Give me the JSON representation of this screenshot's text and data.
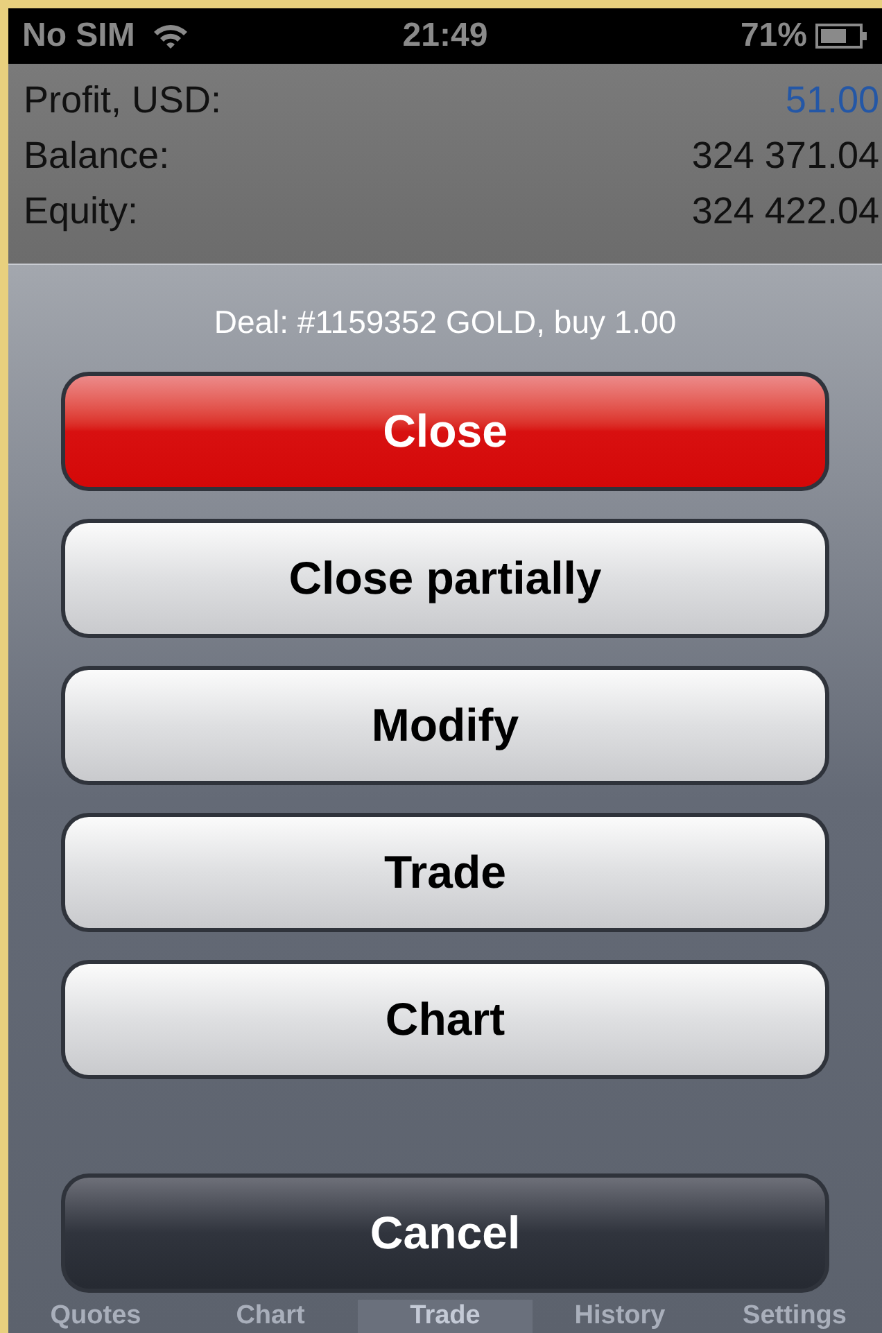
{
  "status_bar": {
    "carrier": "No SIM",
    "time": "21:49",
    "battery": "71%"
  },
  "account_rows": [
    {
      "label": "Profit, USD:",
      "value": "51.00",
      "color": "#2457a6"
    },
    {
      "label": "Balance:",
      "value": "324 371.04",
      "color": "#111111"
    },
    {
      "label": "Equity:",
      "value": "324 422.04",
      "color": "#111111"
    }
  ],
  "action_sheet": {
    "title": "Deal: #1159352 GOLD, buy 1.00",
    "buttons": [
      {
        "label": "Close",
        "kind": "destructive"
      },
      {
        "label": "Close partially",
        "kind": "default"
      },
      {
        "label": "Modify",
        "kind": "default"
      },
      {
        "label": "Trade",
        "kind": "default"
      },
      {
        "label": "Chart",
        "kind": "default"
      },
      {
        "label": "Cancel",
        "kind": "cancel"
      }
    ]
  },
  "tab_bar": [
    {
      "label": "Quotes",
      "selected": false
    },
    {
      "label": "Chart",
      "selected": false
    },
    {
      "label": "Trade",
      "selected": true
    },
    {
      "label": "History",
      "selected": false
    },
    {
      "label": "Settings",
      "selected": false
    }
  ]
}
